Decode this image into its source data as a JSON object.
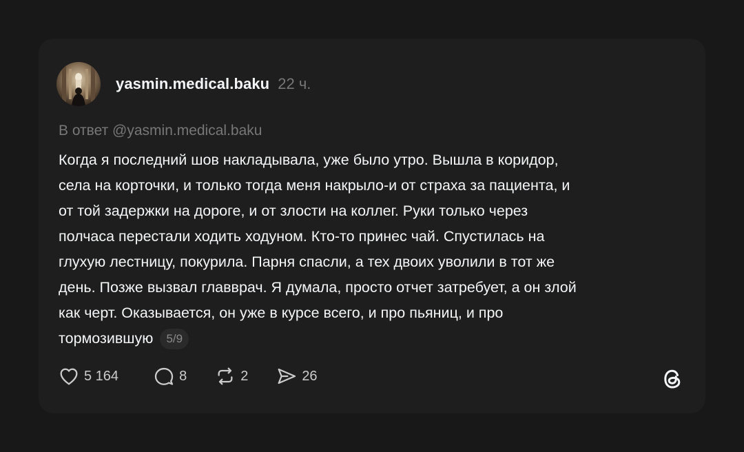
{
  "post": {
    "username": "yasmin.medical.baku",
    "time": "22 ч.",
    "reply_to": "В ответ @yasmin.medical.baku",
    "text": "Когда я последний шов накладывала, уже было утро. Вышла в коридор,\nсела на корточки, и только тогда меня накрыло-и от страха за пациента, и\nот той задержки на дороге, и от злости на коллег. Руки только через\nполчаса перестали ходить ходуном. Кто-то принес чай. Спустилась на\nглухую лестницу, покурила. Парня спасли, а тех двоих уволили в тот же\nдень. Позже вызвал главврач. Я думала, просто отчет затребует, а он злой\nкак черт. Оказывается, он уже в курсе всего, и про пьяниц, и про\nтормозившую",
    "thread_counter": "5/9"
  },
  "actions": {
    "likes": "5 164",
    "replies": "8",
    "reposts": "2",
    "shares": "26"
  },
  "icons": {
    "like": "heart-icon",
    "reply": "comment-icon",
    "repost": "repost-icon",
    "share": "send-icon",
    "brand": "threads-logo-icon"
  }
}
